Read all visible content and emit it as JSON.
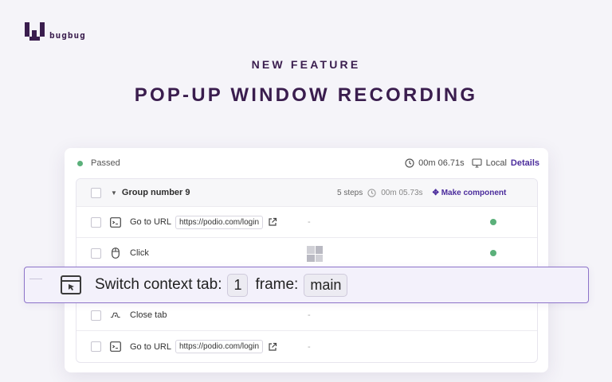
{
  "brand": {
    "name": "bugbug"
  },
  "hero": {
    "eyebrow": "NEW FEATURE",
    "headline": "POP-UP WINDOW RECORDING"
  },
  "run": {
    "status": "Passed",
    "duration": "00m 06.71s",
    "environment": "Local",
    "details_label": "Details",
    "status_color": "#5bb07a"
  },
  "group": {
    "name": "Group number 9",
    "steps_count": "5 steps",
    "duration": "00m 05.73s",
    "make_component_label": "Make component"
  },
  "steps": [
    {
      "icon": "terminal-icon",
      "label": "Go to URL",
      "url": "https://podio.com/login",
      "dash": "-",
      "passed": true
    },
    {
      "icon": "mouse-icon",
      "label": "Click",
      "passed": true
    },
    {
      "icon": "close-tab-icon",
      "label": "Close tab",
      "dash": "-"
    },
    {
      "icon": "terminal-icon",
      "label": "Go to URL",
      "url": "https://podio.com/login",
      "dash": "-"
    }
  ],
  "highlight_step": {
    "icon": "switch-tab-icon",
    "label": "Switch context tab:",
    "tab_value": "1",
    "frame_label": "frame:",
    "frame_value": "main"
  },
  "colors": {
    "brand": "#3a1d4e",
    "accent": "#4b2c9c",
    "highlight_border": "#8d73c9"
  }
}
